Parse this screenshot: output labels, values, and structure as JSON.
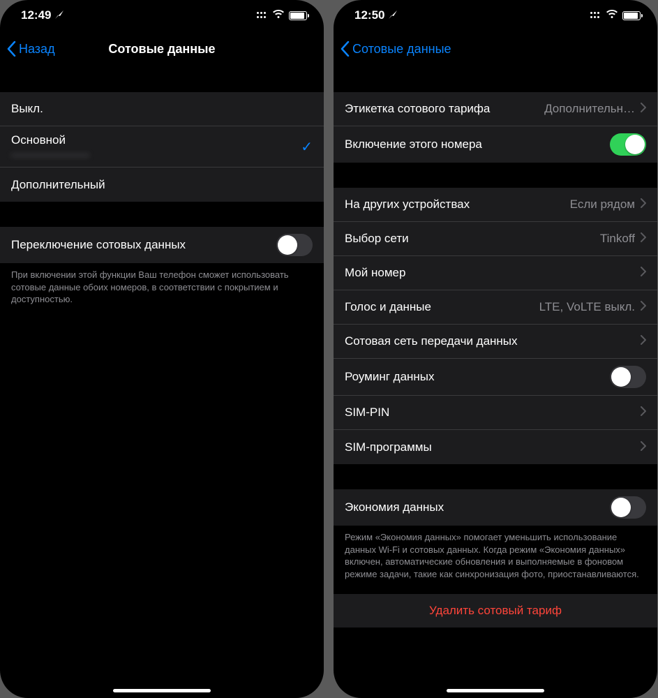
{
  "left": {
    "status": {
      "time": "12:49"
    },
    "nav": {
      "back": "Назад",
      "title": "Сотовые данные"
    },
    "options": {
      "off": "Выкл.",
      "primary": "Основной",
      "primary_sub": "————————",
      "secondary": "Дополнительный"
    },
    "switching": {
      "label": "Переключение сотовых данных",
      "footer": "При включении этой функции Ваш телефон сможет использовать сотовые данные обоих номеров, в соответствии с покрытием и доступностью."
    }
  },
  "right": {
    "status": {
      "time": "12:50"
    },
    "nav": {
      "back": "Сотовые данные"
    },
    "group1": {
      "label_tag": "Этикетка сотового тарифа",
      "label_tag_value": "Дополнительн…",
      "enable_number": "Включение этого номера"
    },
    "group2": {
      "other_devices": "На других устройствах",
      "other_devices_value": "Если рядом",
      "network": "Выбор сети",
      "network_value": "Tinkoff",
      "my_number": "Мой номер",
      "voice_data": "Голос и данные",
      "voice_data_value": "LTE, VoLTE выкл.",
      "cellular_net": "Сотовая сеть передачи данных",
      "roaming": "Роуминг данных",
      "sim_pin": "SIM-PIN",
      "sim_apps": "SIM-программы"
    },
    "group3": {
      "low_data": "Экономия данных",
      "footer": "Режим «Экономия данных» помогает уменьшить использование данных Wi-Fi и сотовых данных. Когда режим «Экономия данных» включен, автоматические обновления и выполняемые в фоновом режиме задачи, такие как синхронизация фото, приостанавливаются."
    },
    "delete": "Удалить сотовый тариф"
  }
}
